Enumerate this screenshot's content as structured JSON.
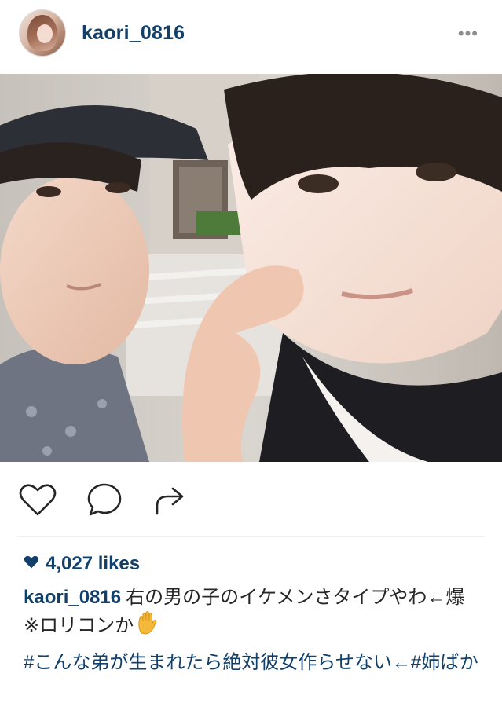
{
  "header": {
    "username": "kaori_0816",
    "more_icon": "more-dots-icon",
    "more_label": "•••"
  },
  "photo": {
    "kind": "photo"
  },
  "actions": {
    "like_icon": "heart-outline-icon",
    "comment_icon": "comment-bubble-icon",
    "share_icon": "share-arrow-icon"
  },
  "likes": {
    "icon": "heart-filled-icon",
    "text": "4,027 likes"
  },
  "caption": {
    "username": "kaori_0816",
    "text": "右の男の子のイケメンさタイプやわ←爆 ※ロリコンか",
    "emoji": "raised-hand-emoji"
  },
  "hashtags": "#こんな弟が生まれたら絶対彼女作らせない←#姉ばか",
  "colors": {
    "link": "#12406b",
    "text": "#262626",
    "muted": "#8e8e8e"
  }
}
